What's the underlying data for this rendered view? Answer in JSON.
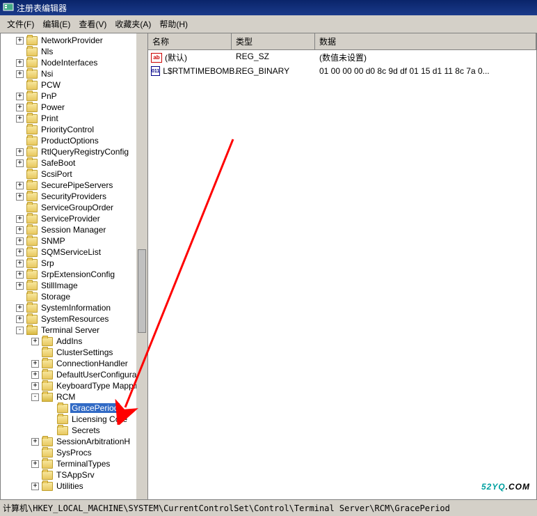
{
  "title": "注册表编辑器",
  "menu": [
    "文件(F)",
    "编辑(E)",
    "查看(V)",
    "收藏夹(A)",
    "帮助(H)"
  ],
  "tree_nodes": [
    {
      "lvl": 0,
      "exp": "+",
      "label": "NetworkProvider"
    },
    {
      "lvl": 0,
      "exp": "",
      "label": "Nls"
    },
    {
      "lvl": 0,
      "exp": "+",
      "label": "NodeInterfaces"
    },
    {
      "lvl": 0,
      "exp": "+",
      "label": "Nsi"
    },
    {
      "lvl": 0,
      "exp": "",
      "label": "PCW"
    },
    {
      "lvl": 0,
      "exp": "+",
      "label": "PnP"
    },
    {
      "lvl": 0,
      "exp": "+",
      "label": "Power"
    },
    {
      "lvl": 0,
      "exp": "+",
      "label": "Print"
    },
    {
      "lvl": 0,
      "exp": "",
      "label": "PriorityControl"
    },
    {
      "lvl": 0,
      "exp": "",
      "label": "ProductOptions"
    },
    {
      "lvl": 0,
      "exp": "+",
      "label": "RtlQueryRegistryConfig"
    },
    {
      "lvl": 0,
      "exp": "+",
      "label": "SafeBoot"
    },
    {
      "lvl": 0,
      "exp": "",
      "label": "ScsiPort"
    },
    {
      "lvl": 0,
      "exp": "+",
      "label": "SecurePipeServers"
    },
    {
      "lvl": 0,
      "exp": "+",
      "label": "SecurityProviders"
    },
    {
      "lvl": 0,
      "exp": "",
      "label": "ServiceGroupOrder"
    },
    {
      "lvl": 0,
      "exp": "+",
      "label": "ServiceProvider"
    },
    {
      "lvl": 0,
      "exp": "+",
      "label": "Session Manager"
    },
    {
      "lvl": 0,
      "exp": "+",
      "label": "SNMP"
    },
    {
      "lvl": 0,
      "exp": "+",
      "label": "SQMServiceList"
    },
    {
      "lvl": 0,
      "exp": "+",
      "label": "Srp"
    },
    {
      "lvl": 0,
      "exp": "+",
      "label": "SrpExtensionConfig"
    },
    {
      "lvl": 0,
      "exp": "+",
      "label": "StillImage"
    },
    {
      "lvl": 0,
      "exp": "",
      "label": "Storage"
    },
    {
      "lvl": 0,
      "exp": "+",
      "label": "SystemInformation"
    },
    {
      "lvl": 0,
      "exp": "+",
      "label": "SystemResources"
    },
    {
      "lvl": 0,
      "exp": "-",
      "label": "Terminal Server",
      "open": true
    },
    {
      "lvl": 1,
      "exp": "+",
      "label": "AddIns"
    },
    {
      "lvl": 1,
      "exp": "",
      "label": "ClusterSettings"
    },
    {
      "lvl": 1,
      "exp": "+",
      "label": "ConnectionHandler"
    },
    {
      "lvl": 1,
      "exp": "+",
      "label": "DefaultUserConfigura"
    },
    {
      "lvl": 1,
      "exp": "+",
      "label": "KeyboardType Mappin"
    },
    {
      "lvl": 1,
      "exp": "-",
      "label": "RCM",
      "open": true
    },
    {
      "lvl": 2,
      "exp": "",
      "label": "GracePeriod",
      "sel": true
    },
    {
      "lvl": 2,
      "exp": "",
      "label": "Licensing Core"
    },
    {
      "lvl": 2,
      "exp": "",
      "label": "Secrets"
    },
    {
      "lvl": 1,
      "exp": "+",
      "label": "SessionArbitrationH"
    },
    {
      "lvl": 1,
      "exp": "",
      "label": "SysProcs"
    },
    {
      "lvl": 1,
      "exp": "+",
      "label": "TerminalTypes"
    },
    {
      "lvl": 1,
      "exp": "",
      "label": "TSAppSrv"
    },
    {
      "lvl": 1,
      "exp": "+",
      "label": "Utilities"
    }
  ],
  "columns": {
    "name": "名称",
    "type": "类型",
    "data": "数据"
  },
  "values": [
    {
      "icon": "str",
      "name": "(默认)",
      "type": "REG_SZ",
      "data": "(数值未设置)"
    },
    {
      "icon": "bin",
      "name": "L$RTMTIMEBOMB...",
      "type": "REG_BINARY",
      "data": "01 00 00 00 d0 8c 9d df 01 15 d1 11 8c 7a 0..."
    }
  ],
  "status": "计算机\\HKEY_LOCAL_MACHINE\\SYSTEM\\CurrentControlSet\\Control\\Terminal Server\\RCM\\GracePeriod",
  "watermark": {
    "part1": "52YQ",
    "part2": ".COM"
  }
}
